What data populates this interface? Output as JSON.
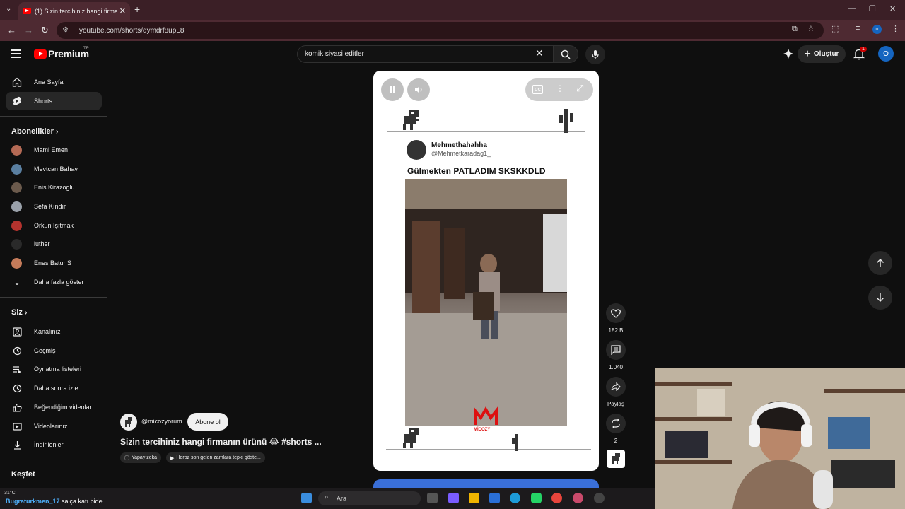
{
  "browser": {
    "tab_title": "(1) Sizin tercihiniz hangi firmanın ürünü",
    "url": "youtube.com/shorts/qymdrf8upL8"
  },
  "header": {
    "logo_text": "Premium",
    "logo_region": "TR",
    "search_value": "komik siyasi editler",
    "create_label": "Oluştur",
    "notification_count": "1",
    "avatar_letter": "O"
  },
  "sidebar": {
    "main": [
      {
        "label": "Ana Sayfa",
        "icon": "home-icon"
      },
      {
        "label": "Shorts",
        "icon": "shorts-icon"
      }
    ],
    "subscriptions_title": "Abonelikler",
    "subscriptions": [
      {
        "label": "Mami Emen",
        "color": "#b46a55"
      },
      {
        "label": "Mevtcan Bahav",
        "color": "#5a7fa0"
      },
      {
        "label": "Enis Kirazoglu",
        "color": "#6b5a4c"
      },
      {
        "label": "Sefa Kındır",
        "color": "#9aa1aa"
      },
      {
        "label": "Orkun Işıtmak",
        "color": "#b5332e"
      },
      {
        "label": "luther",
        "color": "#2a2a2a"
      },
      {
        "label": "Enes Batur S",
        "color": "#c47b5a"
      }
    ],
    "show_more": "Daha fazla göster",
    "you_title": "Siz",
    "you_items": [
      {
        "label": "Kanalınız",
        "icon": "channel-icon"
      },
      {
        "label": "Geçmiş",
        "icon": "history-icon"
      },
      {
        "label": "Oynatma listeleri",
        "icon": "playlist-icon"
      },
      {
        "label": "Daha sonra izle",
        "icon": "watch-later-icon"
      },
      {
        "label": "Beğendiğim videolar",
        "icon": "like-icon"
      },
      {
        "label": "Videolarınız",
        "icon": "your-videos-icon"
      },
      {
        "label": "İndirilenler",
        "icon": "download-icon"
      }
    ],
    "explore_title": "Keşfet"
  },
  "short": {
    "tweet_name": "Mehmethahahha",
    "tweet_handle": "@Mehmetkaradag1_",
    "tweet_text": "Gülmekten PATLADIM SKSKKDLD",
    "watermark": "MİCOZY"
  },
  "actions": {
    "likes": "182 B",
    "comments": "1.040",
    "share": "Paylaş",
    "remix": "2"
  },
  "channel": {
    "name": "@micozyorum",
    "subscribe_label": "Abone ol",
    "title": "Sizin tercihiniz hangi firmanın ürünü 😂 #shorts ...",
    "chip1": "Yapay zeka",
    "chip2": "Horoz son gelen zamlara tepki göste..."
  },
  "taskbar": {
    "weather": "31°C",
    "search_placeholder": "Ara",
    "overlay_user": "Bugraturkmen_17",
    "overlay_msg": "salça katı bide"
  }
}
